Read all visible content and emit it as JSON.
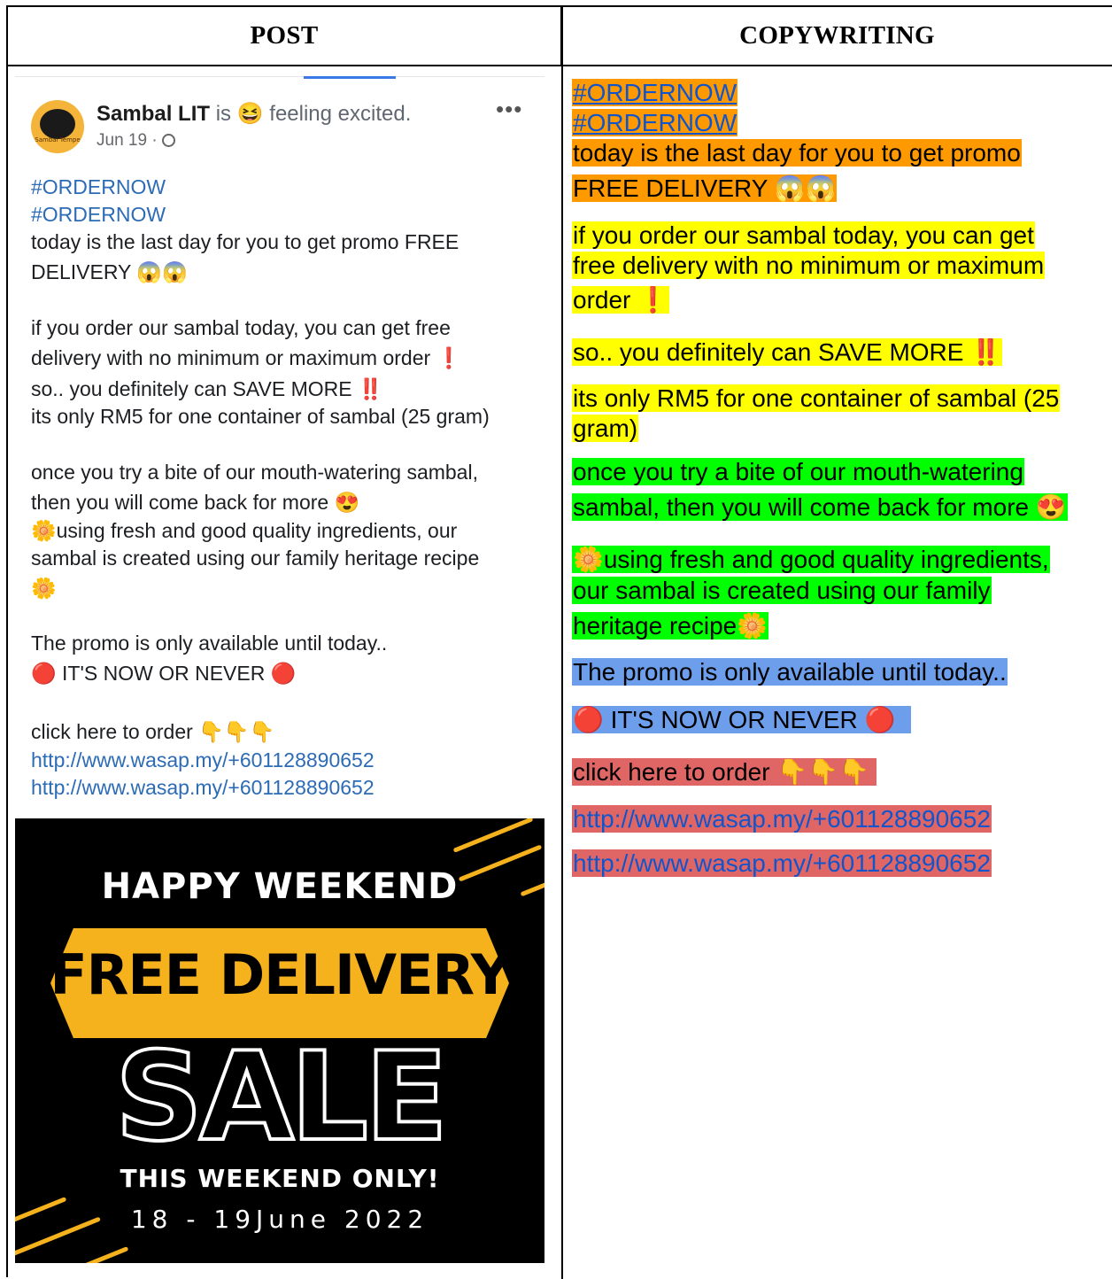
{
  "table": {
    "header_post": "POST",
    "header_copywriting": "COPYWRITING"
  },
  "post": {
    "author": "Sambal LIT",
    "status_is": "is",
    "status_emoji": "😆",
    "status_text": "feeling excited.",
    "date": "Jun 19 ·",
    "more": "•••",
    "avatar_text": "Sambal Tempe",
    "lines": [
      "#ORDERNOW",
      "#ORDERNOW",
      "today is the last day for you to get promo FREE",
      "DELIVERY 😱😱",
      "if you order our sambal today, you can get free",
      "delivery with no minimum or maximum order ❗",
      "so.. you definitely can SAVE MORE ‼️",
      "its only RM5 for one container of sambal (25 gram)",
      "once you try a bite of our mouth-watering sambal,",
      "then you will come back for more 😍",
      "🌼using fresh and good quality ingredients, our",
      "sambal is created using our family heritage recipe",
      "🌼",
      "The promo is only available until today..",
      "🔴 IT'S NOW OR NEVER 🔴",
      "click here to order 👇👇👇",
      "http://www.wasap.my/+601128890652",
      "http://www.wasap.my/+601128890652"
    ],
    "promo_image": {
      "happy": "HAPPY WEEKEND",
      "free": "FREE DELIVERY",
      "sale": "SALE",
      "only": "THIS WEEKEND ONLY!",
      "dates": "18 - 19June 2022",
      "accent_color": "#f5b21c"
    }
  },
  "copywriting": {
    "colors": {
      "orange": "#ff9900",
      "yellow": "#ffff00",
      "green": "#00ff00",
      "blue": "#6d9eeb",
      "red": "#e06666"
    },
    "lines": [
      "#ORDERNOW",
      "#ORDERNOW",
      "today is the last day for you to get promo",
      "FREE DELIVERY 😱😱",
      "if you order our sambal today, you can get",
      "free delivery with no minimum or maximum",
      "order ❗",
      "so.. you definitely can SAVE MORE ‼️",
      "its only RM5 for one container of sambal (25",
      "gram)",
      "once you try a bite of our mouth-watering",
      "sambal, then you will come back for more 😍",
      "🌼using fresh and good quality ingredients,",
      "our sambal is created using our family",
      "heritage recipe🌼",
      "The promo is only available until today..",
      "🔴 IT'S NOW OR NEVER 🔴",
      "click here to order 👇👇👇",
      "http://www.wasap.my/+601128890652",
      "http://www.wasap.my/+601128890652"
    ]
  }
}
